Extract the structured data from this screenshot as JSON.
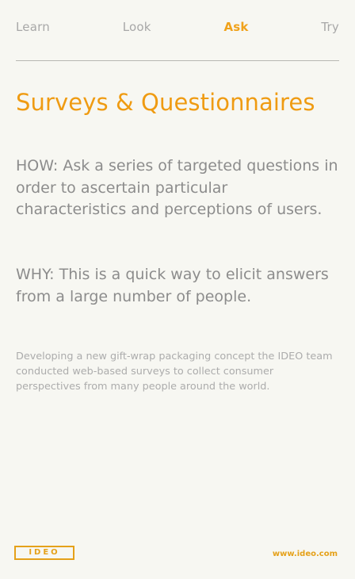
{
  "nav": {
    "learn": "Learn",
    "look": "Look",
    "ask": "Ask",
    "try": "Try"
  },
  "title": "Surveys & Questionnaires",
  "how": "HOW: Ask a series of targeted questions in order to ascertain particular characteristics and perceptions of users.",
  "why": "WHY: This is a quick way to elicit answers from a large number of people.",
  "note": "Developing a new gift-wrap packaging concept the IDEO team conducted web-based surveys to collect consumer perspectives from many people around the world.",
  "footer": {
    "logo": "IDEO",
    "website": "www.ideo.com"
  },
  "colors": {
    "accent": "#EF9B12",
    "text": "#8C8C8C",
    "muted": "#ACACAC",
    "background": "#F7F7F2"
  }
}
